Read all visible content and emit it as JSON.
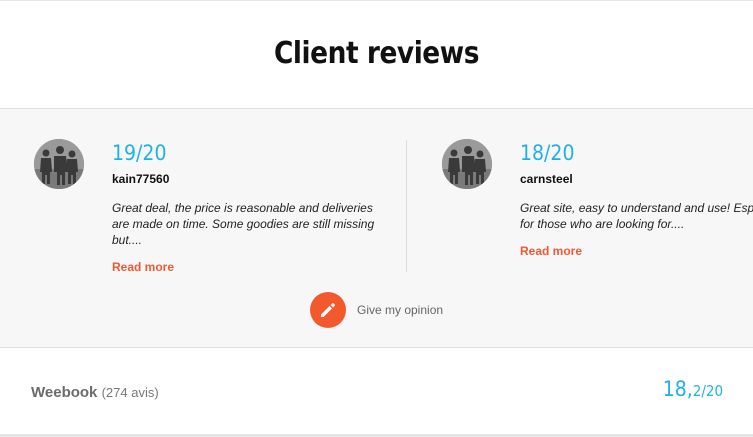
{
  "header": {
    "title": "Client reviews"
  },
  "reviews": [
    {
      "score": "19/20",
      "author": "kain77560",
      "comment": "Great deal, the price is reasonable and deliveries are made on time. Some goodies are still missing but....",
      "read_more": "Read more",
      "avatar_icon": "people-silhouette-avatar"
    },
    {
      "score": "18/20",
      "author": "carnsteel",
      "comment": "Great site, easy to understand and use! Especially for those who are looking for....",
      "read_more": "Read more",
      "avatar_icon": "people-silhouette-avatar"
    }
  ],
  "opinion": {
    "label": "Give my opinion",
    "icon": "pencil-icon"
  },
  "summary": {
    "shop_name": "Weebook",
    "review_count": "(274 avis)",
    "score_main": "18,",
    "score_rest": "2/20"
  },
  "colors": {
    "accent_blue": "#1fb1e6",
    "accent_orange": "#ef5a34",
    "panel_bg": "#f7f7f7"
  }
}
